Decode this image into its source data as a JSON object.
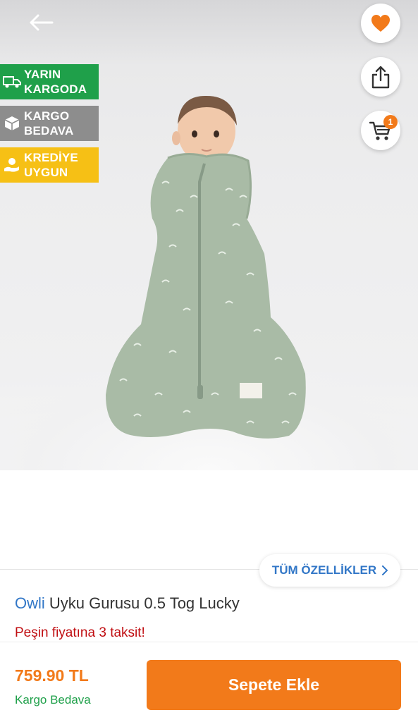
{
  "header": {
    "back_icon": "arrow-left-icon",
    "favorite_icon": "heart-icon",
    "share_icon": "share-icon",
    "cart_icon": "cart-icon",
    "cart_count": "1"
  },
  "badges": [
    {
      "line1": "YARIN",
      "line2": "KARGODA",
      "icon": "truck-icon",
      "color": "#1fa04a"
    },
    {
      "line1": "KARGO",
      "line2": "BEDAVA",
      "icon": "box-icon",
      "color": "#8d8d8d"
    },
    {
      "line1": "KREDİYE",
      "line2": "UYGUN",
      "icon": "credit-hand-icon",
      "color": "#f6c015"
    }
  ],
  "product": {
    "specs_label": "TÜM ÖZELLİKLER",
    "brand": "Owli",
    "name": "Uyku Gurusu 0.5 Tog Lucky",
    "promo": "Peşin fiyatına 3 taksit!",
    "price": "759.90 TL",
    "shipping": "Kargo Bedava",
    "add_to_cart": "Sepete Ekle"
  },
  "colors": {
    "accent": "#f27a1a",
    "brand_blue": "#3277c7",
    "promo_red": "#c00e12",
    "green": "#1fa04a"
  }
}
